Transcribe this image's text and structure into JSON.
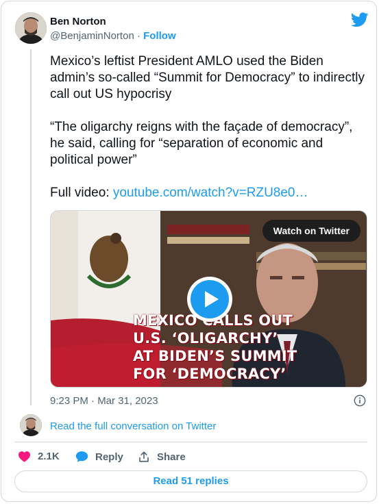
{
  "author": {
    "name": "Ben Norton",
    "handle": "@BenjaminNorton",
    "follow_label": "Follow",
    "separator": "·"
  },
  "tweet": {
    "intro": "Mexico’s leftist President AMLO used the Biden admin’s so-called “Summit for Democracy” to indirectly call out US hypocrisy\n\n“The oligarchy reigns with the façade of democracy”, he said, calling for “separation of economic and political power”\n\nFull video: ",
    "link": "youtube.com/watch?v=RZU8e0…"
  },
  "media": {
    "watch_label": "Watch on Twitter",
    "headline_lines": [
      "MEXICO CALLS OUT",
      "U.S. ‘OLIGARCHY’",
      "AT BIDEN’S SUMMIT",
      "FOR ‘DEMOCRACY’"
    ]
  },
  "meta": {
    "timestamp": "9:23 PM · Mar 31, 2023"
  },
  "conversation": {
    "label": "Read the full conversation on Twitter"
  },
  "actions": {
    "likes": "2.1K",
    "reply_label": "Reply",
    "share_label": "Share"
  },
  "replies_button": "Read 51 replies",
  "colors": {
    "accent": "#1d9bf0",
    "like": "#f91880",
    "muted": "#536471",
    "border": "#cfd9de"
  },
  "icons": [
    "twitter-bird-icon",
    "play-icon",
    "info-icon",
    "heart-icon",
    "reply-bubble-icon",
    "share-icon"
  ]
}
